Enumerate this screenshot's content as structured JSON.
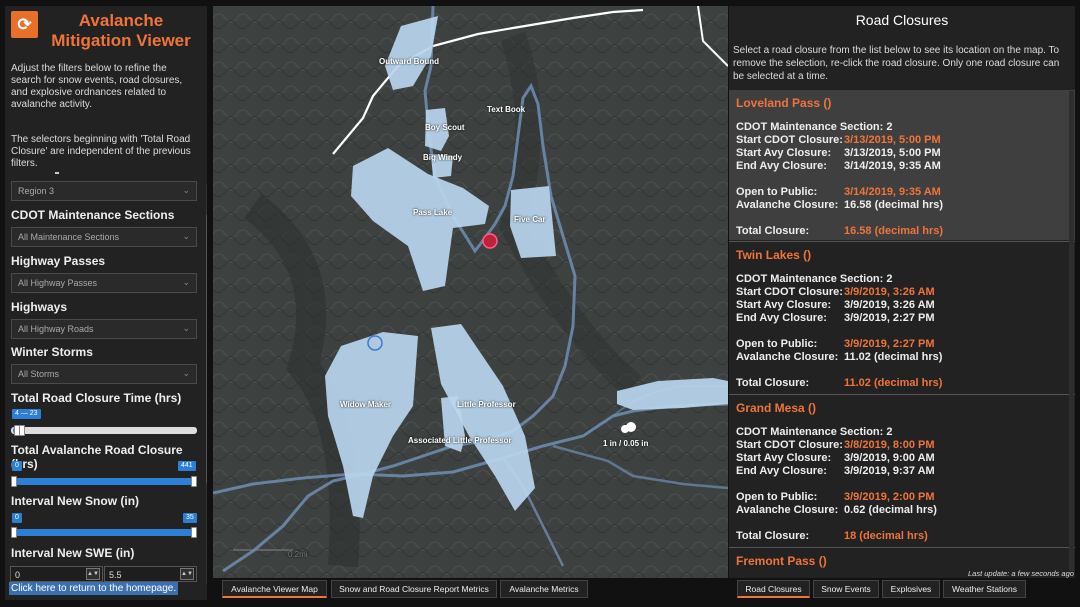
{
  "app": {
    "title_line1": "Avalanche",
    "title_line2": "Mitigation Viewer",
    "logo_glyph": "⟳"
  },
  "left": {
    "intro": "Adjust the filters below to refine the search for snow events, road closures, and explosive ordnances related to avalanche activity.",
    "note": "The selectors beginning with 'Total Road Closure' are independent of the previous filters.",
    "region_select": "Region 3",
    "cdot_label": "CDOT Maintenance Sections",
    "cdot_select": "All Maintenance Sections",
    "passes_label": "Highway Passes",
    "passes_select": "All Highway Passes",
    "highways_label": "Highways",
    "highways_select": "All Highway Roads",
    "storms_label": "Winter Storms",
    "storms_select": "All Storms",
    "total_road_label": "Total Road Closure Time (hrs)",
    "total_road_badge": "4 — 23",
    "total_road_range": {
      "min": 4,
      "max": 23,
      "domain": [
        0,
        441
      ]
    },
    "total_avy_label": "Total Avalanche Road Closure (hrs)",
    "total_avy_min": "0",
    "total_avy_max": "441",
    "snow_label": "Interval New Snow (in)",
    "snow_min": "0",
    "snow_max": "35",
    "swe_label": "Interval New SWE (in)",
    "swe_min": "0",
    "swe_max": "5.5",
    "home_link": "Click here to return to the homepage."
  },
  "map": {
    "labels": {
      "outward_bound": "Outward Bound",
      "text_book": "Text Book",
      "boy_scout": "Boy Scout",
      "big_windy": "Big Windy",
      "pass_lake": "Pass Lake",
      "five_car": "Five Car",
      "widow_maker": "Widow Maker",
      "little_professor": "Little Professor",
      "assoc_little_professor": "Associated Little Professor",
      "snow_readout": "1 in / 0.05 in",
      "scale": "0.2mi"
    }
  },
  "right": {
    "title": "Road Closures",
    "description": "Select a road closure from the list below to see its location on the map. To remove the selection, re-click the road closure. Only one road closure can be selected at a time.",
    "field_labels": {
      "section": "CDOT Maintenance Section:",
      "start_cdot": "Start CDOT Closure:",
      "start_avy": "Start Avy Closure:",
      "end_avy": "End Avy Closure:",
      "open": "Open to Public:",
      "avy_closure": "Avalanche Closure:",
      "total": "Total Closure:"
    },
    "closures": [
      {
        "name": "Loveland Pass ()",
        "section": "2",
        "start_cdot": "3/13/2019, 5:00 PM",
        "start_avy": "3/13/2019, 5:00 PM",
        "end_avy": "3/14/2019, 9:35 AM",
        "open": "3/14/2019, 9:35 AM",
        "avy_closure": "16.58 (decimal hrs)",
        "total": "16.58 (decimal hrs)"
      },
      {
        "name": "Twin Lakes ()",
        "section": "2",
        "start_cdot": "3/9/2019, 3:26 AM",
        "start_avy": "3/9/2019, 3:26 AM",
        "end_avy": "3/9/2019, 2:27 PM",
        "open": "3/9/2019, 2:27 PM",
        "avy_closure": "11.02 (decimal hrs)",
        "total": "11.02 (decimal hrs)"
      },
      {
        "name": "Grand Mesa ()",
        "section": "2",
        "start_cdot": "3/8/2019, 8:00 PM",
        "start_avy": "3/9/2019, 9:00 AM",
        "end_avy": "3/9/2019, 9:37 AM",
        "open": "3/9/2019, 2:00 PM",
        "avy_closure": "0.62 (decimal hrs)",
        "total": "18 (decimal hrs)"
      },
      {
        "name": "Fremont Pass ()"
      }
    ],
    "last_update": "Last update: a few seconds ago"
  },
  "tabs_left": [
    "Avalanche Viewer Map",
    "Snow and Road Closure Report Metrics",
    "Avalanche Metrics"
  ],
  "tabs_right": [
    "Road Closures",
    "Snow Events",
    "Explosives",
    "Weather Stations"
  ],
  "colors": {
    "accent": "#f0743a",
    "slider": "#2b7fd4",
    "path": "#9fc4e6",
    "marker": "#c0203a"
  }
}
